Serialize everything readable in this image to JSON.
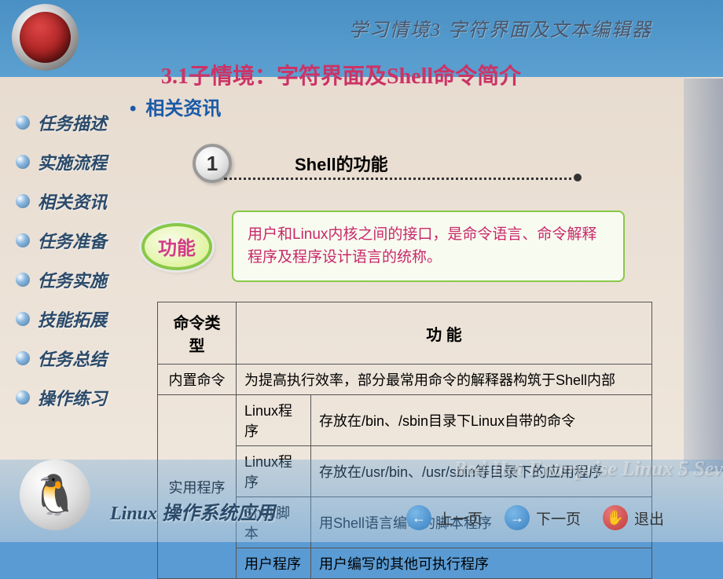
{
  "header": {
    "context_title": "学习情境3  字符界面及文本编辑器",
    "slide_title": "3.1子情境：字符界面及Shell命令简介"
  },
  "sidebar": {
    "items": [
      {
        "label": "任务描述"
      },
      {
        "label": "实施流程"
      },
      {
        "label": "相关资讯"
      },
      {
        "label": "任务准备"
      },
      {
        "label": "任务实施"
      },
      {
        "label": "技能拓展"
      },
      {
        "label": "任务总结"
      },
      {
        "label": "操作练习"
      }
    ]
  },
  "content": {
    "section_header": "相关资讯",
    "topic_number": "1",
    "topic_label": "Shell的功能",
    "feature_badge": "功能",
    "feature_desc": "用户和Linux内核之间的接口，是命令语言、命令解释程序及程序设计语言的统称。",
    "table": {
      "headers": [
        "命令类型",
        "功  能"
      ],
      "rows": [
        {
          "type": "内置命令",
          "subtype": "",
          "desc": "为提高执行效率，部分最常用命令的解释器构筑于Shell内部",
          "rowspan_type": 1,
          "colspan_desc": 2
        },
        {
          "type": "实用程序",
          "subtype": "Linux程序",
          "desc": "存放在/bin、/sbin目录下Linux自带的命令",
          "rowspan_type": 4
        },
        {
          "type": "",
          "subtype": "Linux程序",
          "desc": "存放在/usr/bin、/usr/sbin等目录下的应用程序"
        },
        {
          "type": "",
          "subtype": "Shell脚本",
          "desc": "用Shell语言编写的脚本程序"
        },
        {
          "type": "",
          "subtype": "用户程序",
          "desc": "用户编写的其他可执行程序"
        }
      ]
    }
  },
  "footer": {
    "bg_text": "Red Hat Enterprise Linux 5 Sev",
    "title": "Linux 操作系统应用",
    "nav": {
      "prev": "上一页",
      "next": "下一页",
      "exit": "退出"
    }
  }
}
